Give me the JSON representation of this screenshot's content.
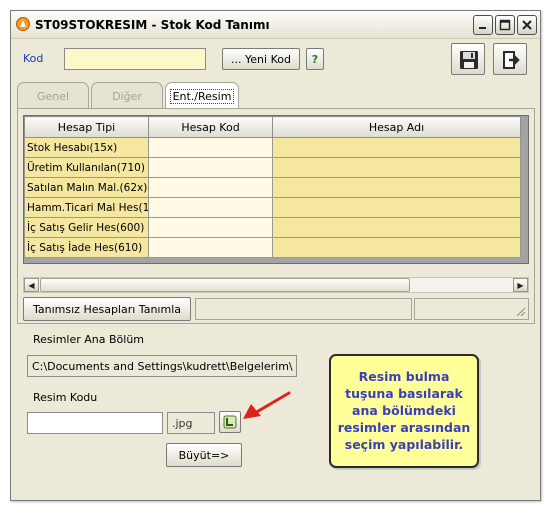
{
  "window": {
    "title": "ST09STOKRESIM - Stok Kod Tanımı"
  },
  "header": {
    "kod_label": "Kod",
    "kod_value": "",
    "new_code_label": "... Yeni Kod",
    "help_label": "?"
  },
  "tabs": [
    {
      "label": "Genel",
      "active": false
    },
    {
      "label": "Diğer",
      "active": false
    },
    {
      "label": "Ent./Resim",
      "active": true
    }
  ],
  "grid": {
    "columns": [
      "Hesap Tipi",
      "Hesap Kod",
      "Hesap Adı"
    ],
    "rows": [
      {
        "type": "Stok Hesabı(15x)",
        "code": "",
        "name": ""
      },
      {
        "type": "Üretim Kullanılan(710)",
        "code": "",
        "name": ""
      },
      {
        "type": "Satılan Malın Mal.(62x)",
        "code": "",
        "name": ""
      },
      {
        "type": "Hamm.Ticari Mal Hes(1...",
        "code": "",
        "name": ""
      },
      {
        "type": "İç Satış Gelir Hes(600)",
        "code": "",
        "name": ""
      },
      {
        "type": "İç Satış İade Hes(610)",
        "code": "",
        "name": ""
      }
    ]
  },
  "actions": {
    "define_accounts_label": "Tanımsız Hesapları Tanımla"
  },
  "images": {
    "main_section_label": "Resimler Ana Bölüm",
    "main_section_path": "C:\\Documents and Settings\\kudrett\\Belgelerim\\",
    "code_label": "Resim Kodu",
    "code_value": "",
    "extension": ".jpg",
    "enlarge_label": "Büyüt=>"
  },
  "callout": {
    "text": "Resim bulma\ntuşuna basılarak\nana bölümdeki\nresimler arasından\nseçim yapılabilir."
  },
  "icons": {
    "app": "app-logo-icon",
    "minimize": "minimize-icon",
    "maximize": "maximize-icon",
    "close": "close-icon",
    "save": "floppy-disk-icon",
    "exit": "exit-door-icon",
    "browse": "browse-image-icon",
    "arrow": "red-arrow-icon"
  },
  "colors": {
    "account_cell": "#f5e6a0",
    "code_cell": "#fffbe6",
    "kod_input": "#fdf8c9",
    "callout_bg": "#ffff99",
    "callout_text": "#3b3fb9",
    "arrow": "#e0221b"
  }
}
